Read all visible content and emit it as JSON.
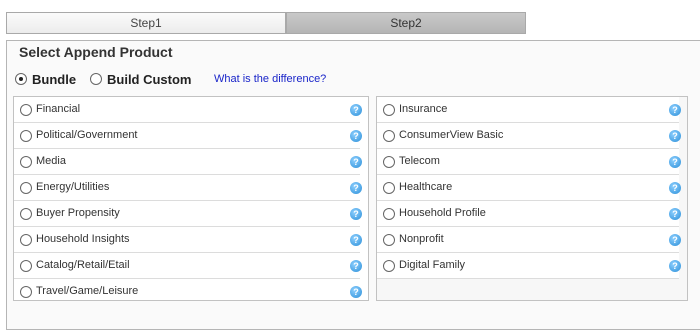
{
  "tabs": [
    {
      "label": "Step1"
    },
    {
      "label": "Step2"
    }
  ],
  "panel": {
    "title": "Select Append Product",
    "mode_options": [
      {
        "label": "Bundle",
        "selected": true
      },
      {
        "label": "Build Custom",
        "selected": false
      }
    ],
    "difference_link": "What is the difference?"
  },
  "left_products": [
    "Financial",
    "Political/Government",
    "Media",
    "Energy/Utilities",
    "Buyer Propensity",
    "Household Insights",
    "Catalog/Retail/Etail",
    "Travel/Game/Leisure"
  ],
  "right_products": [
    "Insurance",
    "ConsumerView Basic",
    "Telecom",
    "Healthcare",
    "Household Profile",
    "Nonprofit",
    "Digital Family"
  ],
  "help_glyph": "?",
  "icons": {
    "help": "help-question-icon",
    "radio": "radio-button"
  },
  "colors": {
    "link": "#1a25c9",
    "help_icon": "#2b8fd8",
    "active_tab": "#b5b5b5"
  }
}
